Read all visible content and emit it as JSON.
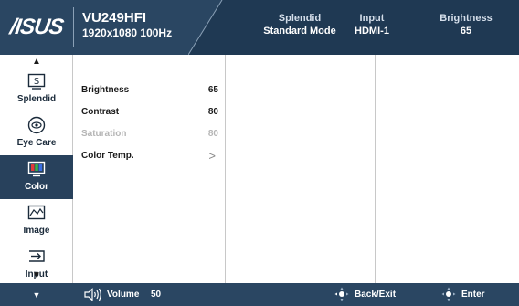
{
  "header": {
    "brand": "/ISUS",
    "model": "VU249HFI",
    "resolution": "1920x1080 100Hz",
    "status": [
      {
        "label": "Splendid",
        "value": "Standard Mode"
      },
      {
        "label": "Input",
        "value": "HDMI-1"
      },
      {
        "label": "Brightness",
        "value": "65"
      }
    ]
  },
  "sidebar": {
    "items": [
      {
        "label": "Splendid",
        "icon": "splendid-icon"
      },
      {
        "label": "Eye Care",
        "icon": "eye-icon"
      },
      {
        "label": "Color",
        "icon": "color-bars-icon",
        "active": true
      },
      {
        "label": "Image",
        "icon": "image-wave-icon"
      },
      {
        "label": "Input",
        "icon": "input-arrow-icon"
      }
    ]
  },
  "color_menu": {
    "rows": [
      {
        "label": "Brightness",
        "value": "65",
        "enabled": true
      },
      {
        "label": "Contrast",
        "value": "80",
        "enabled": true
      },
      {
        "label": "Saturation",
        "value": "80",
        "enabled": false
      },
      {
        "label": "Color Temp.",
        "value": ">",
        "enabled": true
      }
    ]
  },
  "footer": {
    "volume_label": "Volume",
    "volume_value": "50",
    "back_label": "Back/Exit",
    "enter_label": "Enter"
  },
  "colors": {
    "header_bg": "#2a4662",
    "header_dark": "#1f3953",
    "active_item": "#28415c",
    "dim_text": "#b5b5b5"
  }
}
